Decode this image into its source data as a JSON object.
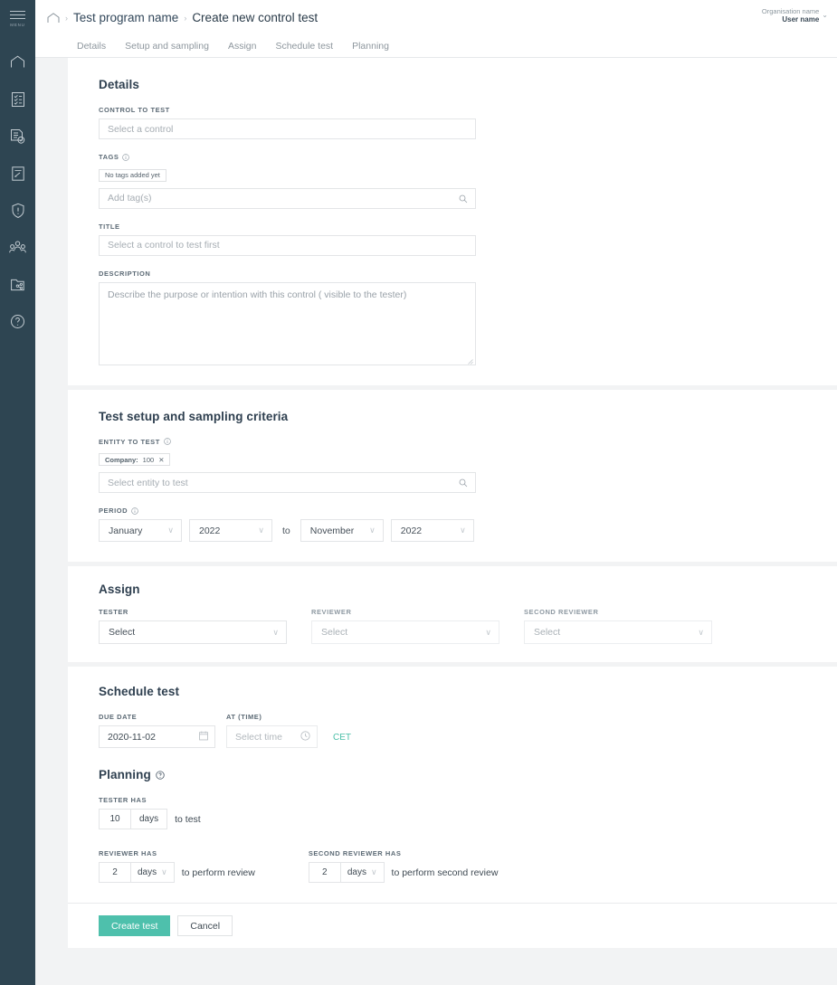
{
  "sidebar": {
    "menu_label": "MENU",
    "items": [
      {
        "icon": "home-icon",
        "name": "nav-home"
      },
      {
        "icon": "checklist-document-icon",
        "name": "nav-programs"
      },
      {
        "icon": "document-check-icon",
        "name": "nav-controls"
      },
      {
        "icon": "document-edit-icon",
        "name": "nav-tests"
      },
      {
        "icon": "shield-alert-icon",
        "name": "nav-risks"
      },
      {
        "icon": "users-group-icon",
        "name": "nav-people"
      },
      {
        "icon": "folder-share-icon",
        "name": "nav-reports"
      },
      {
        "icon": "help-circle-icon",
        "name": "nav-help"
      }
    ]
  },
  "topbar": {
    "home_icon": "home-icon",
    "breadcrumb": [
      "Test program name",
      "Create new control test"
    ],
    "separator": "›",
    "organisation_name": "Organisation name",
    "user_name": "User name",
    "chevron": "⌄"
  },
  "tabs": [
    {
      "label": "Details"
    },
    {
      "label": "Setup and sampling"
    },
    {
      "label": "Assign"
    },
    {
      "label": "Schedule test"
    },
    {
      "label": "Planning"
    }
  ],
  "details": {
    "heading": "Details",
    "control_to_test": {
      "label": "CONTROL TO TEST",
      "placeholder": "Select a control",
      "value": ""
    },
    "tags": {
      "label": "TAGS",
      "info_icon": "info-circle-icon",
      "empty_pill": "No tags added yet",
      "placeholder": "Add tag(s)",
      "value": "",
      "search_icon": "search-icon"
    },
    "title": {
      "label": "TITLE",
      "placeholder": "Select a control to test first",
      "value": ""
    },
    "description": {
      "label": "DESCRIPTION",
      "placeholder": "Describe the purpose or intention with this control ( visible to the tester)",
      "value": ""
    }
  },
  "setup": {
    "heading": "Test setup and sampling criteria",
    "entity": {
      "label": "ENTITY TO TEST",
      "info_icon": "info-circle-icon",
      "chips": [
        {
          "prefix": "Company:",
          "value": "100",
          "remove_icon": "close-icon"
        }
      ],
      "placeholder": "Select entity to test",
      "value": "",
      "search_icon": "search-icon"
    },
    "period": {
      "label": "PERIOD",
      "info_icon": "info-circle-icon",
      "from_month": "January",
      "from_year": "2022",
      "to_word": "to",
      "to_month": "November",
      "to_year": "2022",
      "chevron": "∨"
    }
  },
  "assign": {
    "heading": "Assign",
    "fields": [
      {
        "label": "TESTER",
        "value": "Select",
        "disabled": false
      },
      {
        "label": "REVIEWER",
        "value": "Select",
        "disabled": true
      },
      {
        "label": "SECOND REVIEWER",
        "value": "Select",
        "disabled": true
      }
    ],
    "chevron": "∨"
  },
  "schedule": {
    "heading": "Schedule test",
    "due_date": {
      "label": "DUE DATE",
      "value": "2020-11-02",
      "icon": "calendar-icon"
    },
    "at_time": {
      "label": "AT (TIME)",
      "placeholder": "Select time",
      "value": "",
      "icon": "clock-icon"
    },
    "timezone": "CET"
  },
  "planning": {
    "heading": "Planning",
    "help_icon": "question-circle-icon",
    "tester": {
      "label": "TESTER HAS",
      "value": "10",
      "unit": "days",
      "suffix": "to test",
      "has_chevron": false
    },
    "reviewer": {
      "label": "REVIEWER HAS",
      "value": "2",
      "unit": "days",
      "suffix": "to perform review",
      "has_chevron": true
    },
    "second_reviewer": {
      "label": "SECOND REVIEWER HAS",
      "value": "2",
      "unit": "days",
      "suffix": "to perform second review",
      "has_chevron": true
    },
    "chevron": "∨"
  },
  "footer": {
    "primary_label": "Create test",
    "secondary_label": "Cancel"
  },
  "colors": {
    "sidebar_bg": "#2e4552",
    "accent_teal": "#4ec0ac",
    "page_bg": "#f2f3f4",
    "text_dark": "#2f4050",
    "label_grey": "#5c6a75"
  }
}
